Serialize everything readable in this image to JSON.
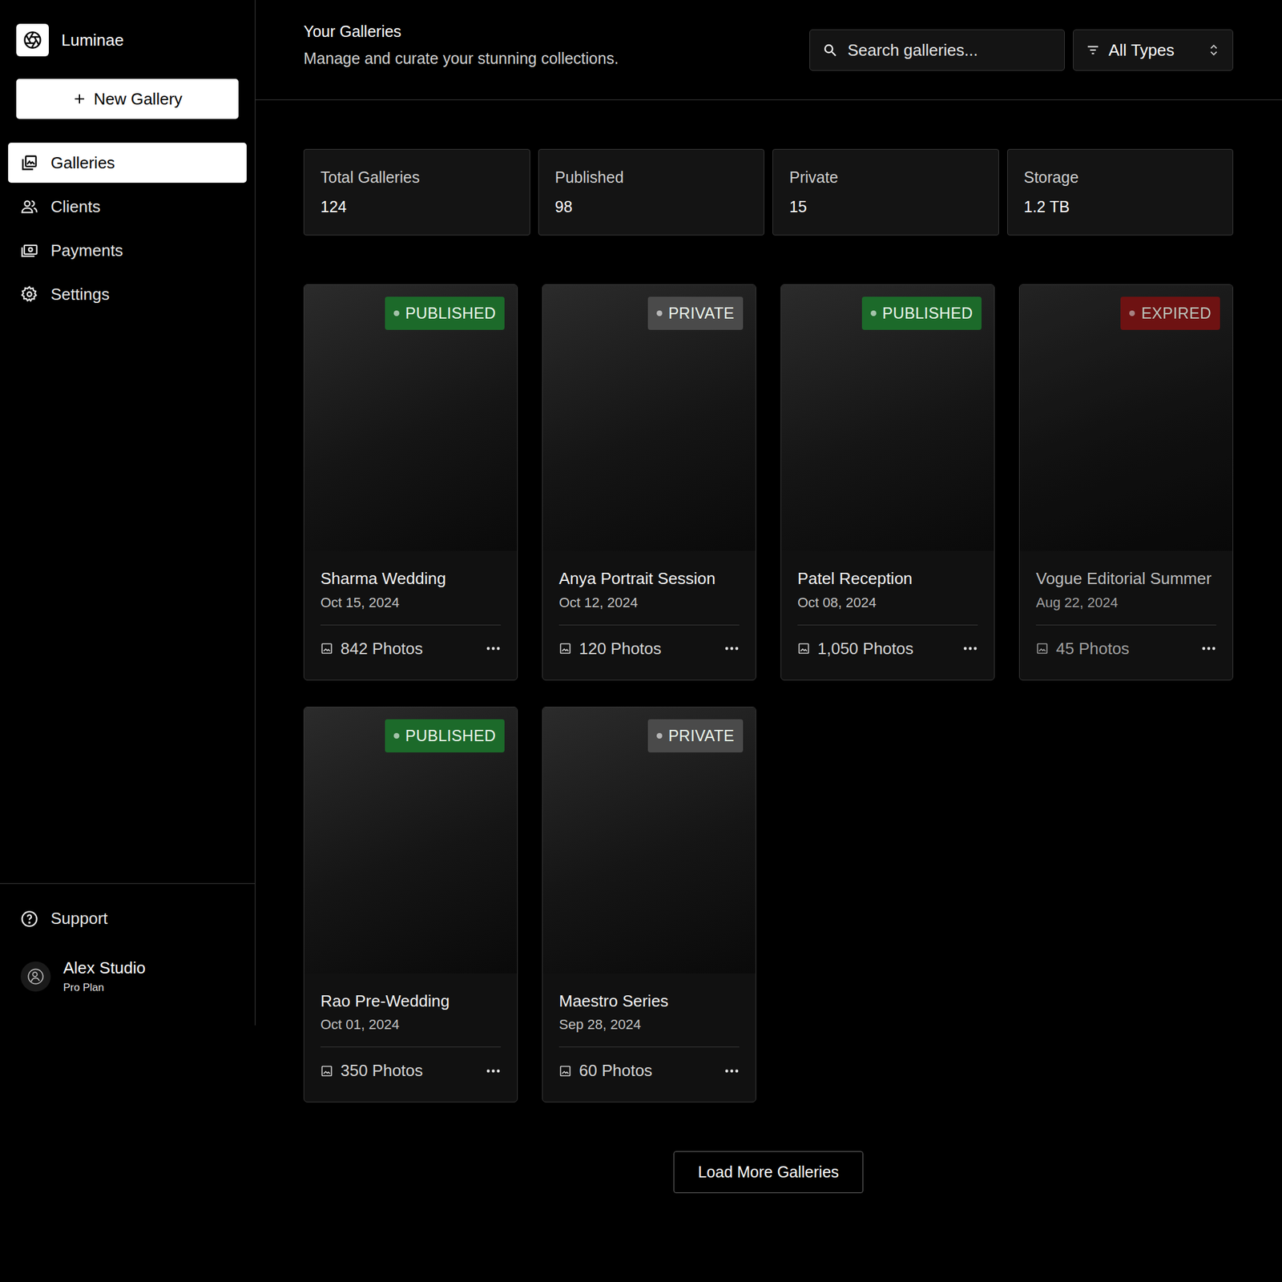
{
  "app": {
    "name": "Luminae"
  },
  "sidebar": {
    "new_button": "New Gallery",
    "items": [
      {
        "label": "Galleries",
        "selected": true
      },
      {
        "label": "Clients",
        "selected": false
      },
      {
        "label": "Payments",
        "selected": false
      },
      {
        "label": "Settings",
        "selected": false
      }
    ],
    "support": "Support",
    "user": {
      "name": "Alex Studio",
      "plan": "Pro Plan"
    }
  },
  "header": {
    "title": "Your Galleries",
    "subtitle": "Manage and curate your stunning collections.",
    "search": {
      "placeholder": "Search galleries..."
    },
    "filter": {
      "value": "All Types"
    }
  },
  "stats": [
    {
      "label": "Total Galleries",
      "value": "124"
    },
    {
      "label": "Published",
      "value": "98"
    },
    {
      "label": "Private",
      "value": "15"
    },
    {
      "label": "Storage",
      "value": "1.2 TB"
    }
  ],
  "galleries": [
    {
      "title": "Sharma Wedding",
      "date": "Oct 15, 2024",
      "photos": "842 Photos",
      "status": "PUBLISHED",
      "color": "#1c6a2a",
      "dimmed": false
    },
    {
      "title": "Anya Portrait Session",
      "date": "Oct 12, 2024",
      "photos": "120 Photos",
      "status": "PRIVATE",
      "color": "#4a4a4a",
      "dimmed": false
    },
    {
      "title": "Patel Reception",
      "date": "Oct 08, 2024",
      "photos": "1,050 Photos",
      "status": "PUBLISHED",
      "color": "#1c6a2a",
      "dimmed": false
    },
    {
      "title": "Vogue Editorial Summer",
      "date": "Aug 22, 2024",
      "photos": "45 Photos",
      "status": "EXPIRED",
      "color": "#8a1616",
      "dimmed": true
    },
    {
      "title": "Rao Pre-Wedding",
      "date": "Oct 01, 2024",
      "photos": "350 Photos",
      "status": "PUBLISHED",
      "color": "#1c6a2a",
      "dimmed": false
    },
    {
      "title": "Maestro Series",
      "date": "Sep 28, 2024",
      "photos": "60 Photos",
      "status": "PRIVATE",
      "color": "#4a4a4a",
      "dimmed": false
    }
  ],
  "load_more": "Load More Galleries"
}
